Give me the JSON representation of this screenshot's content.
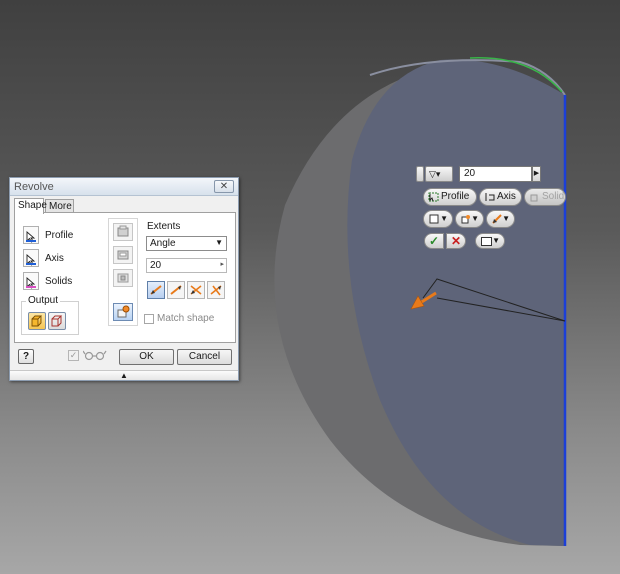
{
  "dialog": {
    "title": "Revolve",
    "close_glyph": "✕",
    "tabs": [
      {
        "label": "Shape",
        "active": true
      },
      {
        "label": "More",
        "active": false
      }
    ],
    "selectors": [
      {
        "label": "Profile",
        "icon": "profile-select-icon",
        "color": "#1f5fd6"
      },
      {
        "label": "Axis",
        "icon": "axis-select-icon",
        "color": "#1f5fd6"
      },
      {
        "label": "Solids",
        "icon": "solids-select-icon",
        "color": "#d94fc3"
      }
    ],
    "output": {
      "label": "Output",
      "buttons": [
        {
          "icon": "solid-output-icon",
          "active": true
        },
        {
          "icon": "surface-output-icon",
          "active": false
        }
      ]
    },
    "operation_buttons": [
      {
        "icon": "join-icon",
        "active": false
      },
      {
        "icon": "cut-icon",
        "active": false
      },
      {
        "icon": "intersect-icon",
        "active": false
      },
      {
        "icon": "new-solid-icon",
        "active": true
      }
    ],
    "extents": {
      "label": "Extents",
      "type_value": "Angle",
      "type_arrow": "▼",
      "angle_value": "20",
      "angle_arrow": "▸",
      "direction_buttons": [
        {
          "icon": "direction-1-icon",
          "active": true
        },
        {
          "icon": "direction-2-icon",
          "active": false
        },
        {
          "icon": "symmetric-icon",
          "active": false
        },
        {
          "icon": "asymmetric-icon",
          "active": false
        }
      ]
    },
    "match_shape_label": "Match shape",
    "help_label": "?",
    "preview_check": "✓",
    "ok_label": "OK",
    "cancel_label": "Cancel",
    "expander_glyph": "▲"
  },
  "mini_toolbar": {
    "dropdown_glyph": "▽▾",
    "value": "20",
    "value_arrow": "▶",
    "profile_label": "Profile",
    "axis_label": "Axis",
    "solid_label": "Solid",
    "dropdown_arrow": "▼",
    "ok_glyph": "✓",
    "cancel_glyph": "✕"
  },
  "viewport": {
    "colors": {
      "face": "#5e6479",
      "side": "#6b6b6d",
      "edge_blue": "#1b3fd8",
      "edge_green": "#39b449",
      "arrow": "#e87a1a"
    }
  }
}
